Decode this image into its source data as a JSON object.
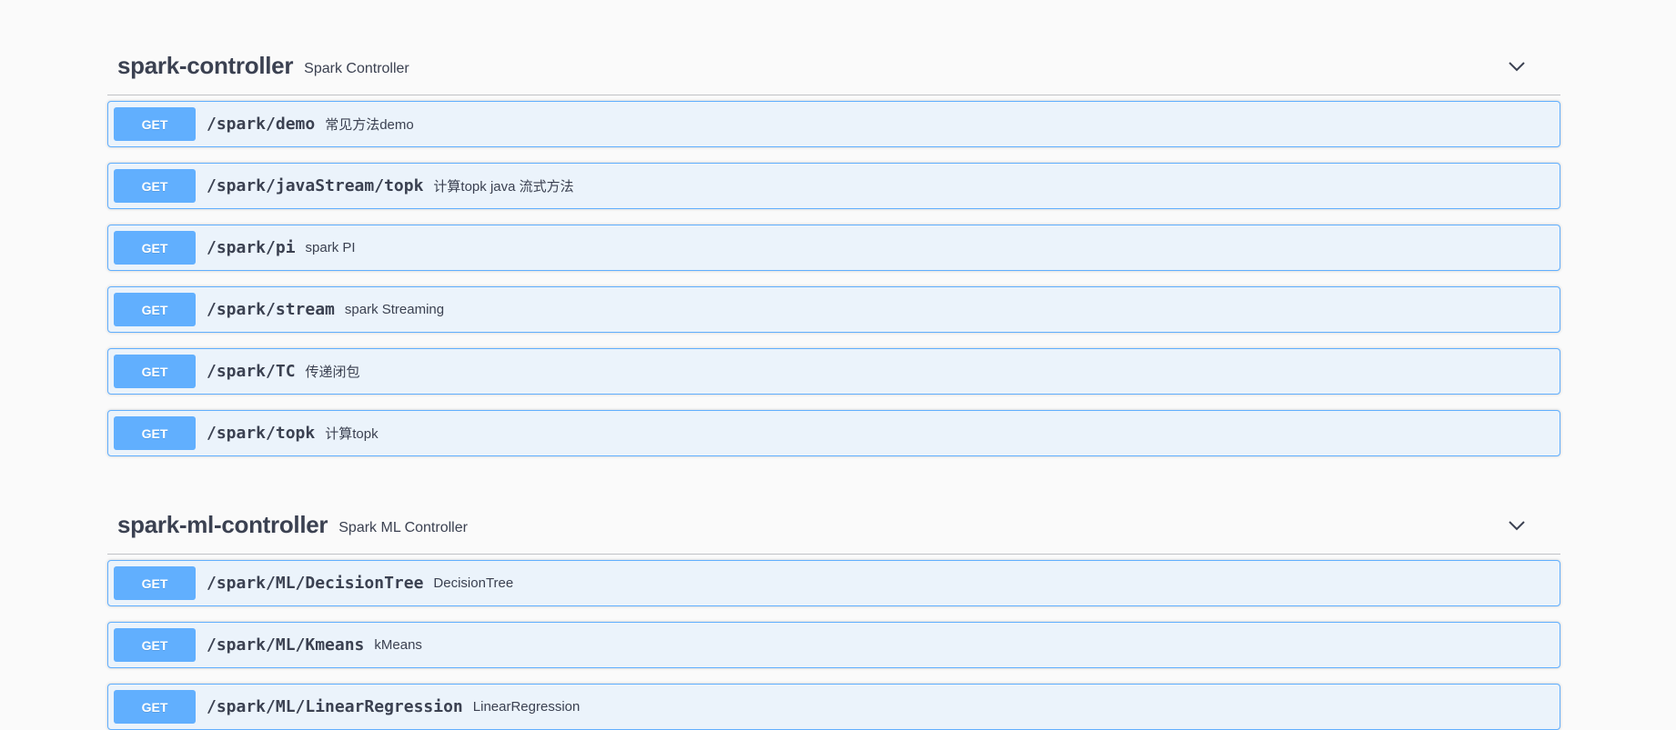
{
  "sections": [
    {
      "title": "spark-controller",
      "description": "Spark Controller",
      "operations": [
        {
          "method": "GET",
          "path": "/spark/demo",
          "summary": "常见方法demo"
        },
        {
          "method": "GET",
          "path": "/spark/javaStream/topk",
          "summary": "计算topk java 流式方法"
        },
        {
          "method": "GET",
          "path": "/spark/pi",
          "summary": "spark PI"
        },
        {
          "method": "GET",
          "path": "/spark/stream",
          "summary": "spark Streaming"
        },
        {
          "method": "GET",
          "path": "/spark/TC",
          "summary": "传递闭包"
        },
        {
          "method": "GET",
          "path": "/spark/topk",
          "summary": "计算topk"
        }
      ]
    },
    {
      "title": "spark-ml-controller",
      "description": "Spark ML Controller",
      "operations": [
        {
          "method": "GET",
          "path": "/spark/ML/DecisionTree",
          "summary": "DecisionTree"
        },
        {
          "method": "GET",
          "path": "/spark/ML/Kmeans",
          "summary": "kMeans"
        },
        {
          "method": "GET",
          "path": "/spark/ML/LinearRegression",
          "summary": "LinearRegression"
        }
      ]
    }
  ],
  "icons": {
    "collapse": "chevron-down-icon"
  },
  "colors": {
    "get_method": "#61affe",
    "get_background": "#ebf3fb",
    "text": "#3b4151",
    "page_background": "#fafafa"
  }
}
